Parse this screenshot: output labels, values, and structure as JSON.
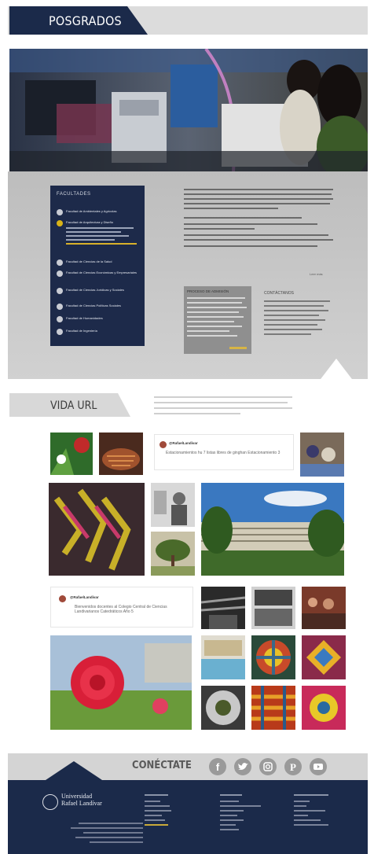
{
  "header": {
    "title": "POSGRADOS"
  },
  "facultades": {
    "title": "FACULTADES",
    "items": [
      {
        "label": "Facultad de Ambientales y Agrícolas",
        "active": false
      },
      {
        "label": "Facultad de Arquitectura y Diseño",
        "active": true
      },
      {
        "label": "Facultad de Ciencias de la Salud",
        "active": false
      },
      {
        "label": "Facultad de Ciencias Económicas y Empresariales",
        "active": false
      },
      {
        "label": "Facultad de Ciencias Jurídicas y Sociales",
        "active": false
      },
      {
        "label": "Facultad de Ciencias Políticas Sociales",
        "active": false
      },
      {
        "label": "Facultad de Humanidades",
        "active": false
      },
      {
        "label": "Facultad de Ingeniería",
        "active": false
      }
    ]
  },
  "promo": {
    "title": "PROCESO DE ADMISIÓN"
  },
  "contact": {
    "title": "CONTÁCTANOS"
  },
  "leer_mas": "Leer más",
  "vida_url": {
    "title": "VIDA URL"
  },
  "tweets": [
    {
      "user": "@RafaelLandivar",
      "text": "Estacionamientos hu 7 listas libres de ginghan Estacionamiento 3"
    },
    {
      "user": "@RafaelLandivar",
      "text": "Bienvenidos docentes al Colegio Central de Ciencias Landivarianos Catedráticos Año 5"
    }
  ],
  "conectate": {
    "title": "CONÉCTATE",
    "icons": [
      "facebook-icon",
      "twitter-icon",
      "instagram-icon",
      "pinterest-icon",
      "youtube-icon"
    ]
  },
  "footer": {
    "logo_line1": "Universidad",
    "logo_line2": "Rafael Landívar"
  },
  "colors": {
    "navy": "#1b2a4a",
    "gold": "#d8b318",
    "gray_band": "#d4d4d4"
  }
}
